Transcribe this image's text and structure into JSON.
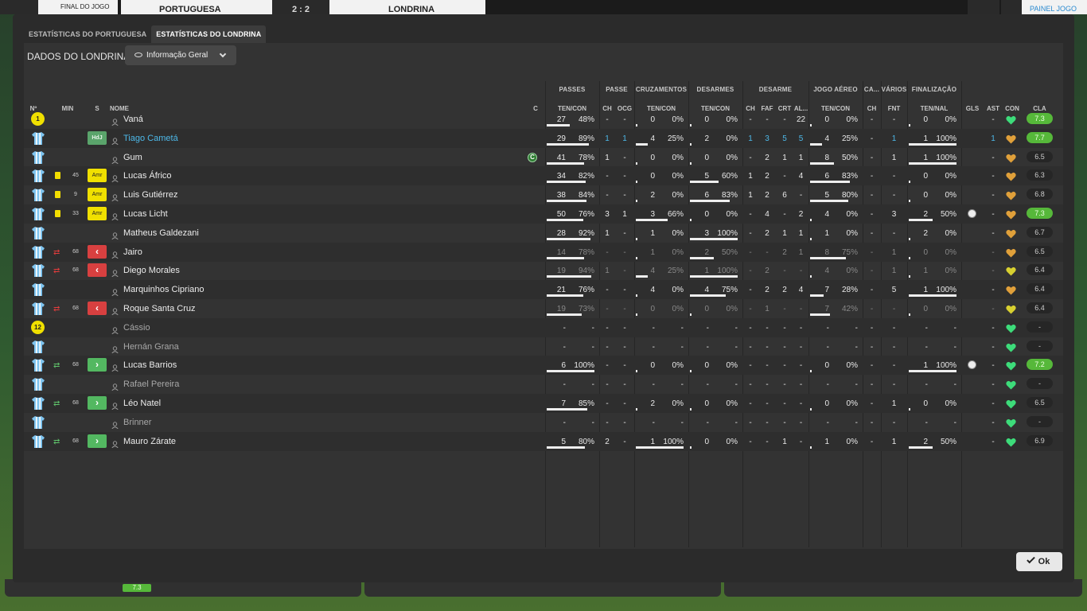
{
  "scoreboard": {
    "status": "FINAL DO JOGO",
    "home_team": "PORTUGUESA",
    "score": "2 : 2",
    "away_team": "LONDRINA",
    "right_label": "PAINEL JOGO"
  },
  "tabs": [
    {
      "label": "ESTATÍSTICAS DO PORTUGUESA",
      "active": false
    },
    {
      "label": "ESTATÍSTICAS DO LONDRINA",
      "active": true
    }
  ],
  "header": {
    "title": "DADOS DO LONDRINA",
    "view_select": "Informação Geral"
  },
  "group_headers": {
    "passes": "PASSES",
    "passe": "PASSE",
    "cruzamentos": "CRUZAMENTOS",
    "desarmes": "DESARMES",
    "desarme": "DESARME",
    "jogo_aereo": "JOGO AÉREO",
    "ca": "CA...",
    "varios": "VÁRIOS",
    "finalizacao": "FINALIZAÇÃO"
  },
  "columns": {
    "num": "Nº",
    "min": "MIN",
    "s": "S",
    "nome": "NOME",
    "c": "C",
    "passes_tencon": "TEN/CON",
    "passe_ch": "CH",
    "passe_ocg": "OCG",
    "cruz_tencon": "TEN/CON",
    "desarmes_tencon": "TEN/CON",
    "des_ch": "CH",
    "des_faf": "FAF",
    "des_crt": "CRT",
    "des_al": "AL...",
    "aereo_tencon": "TEN/CON",
    "ca_ch": "CH",
    "var_fnt": "FNT",
    "fin_tennal": "TEN/NAL",
    "gls": "GLS",
    "ast": "AST",
    "con": "CON",
    "cla": "CLA"
  },
  "rows": [
    {
      "kit": "gk",
      "num": "1",
      "name": "Vaná",
      "card": false,
      "min": "",
      "tag": "",
      "tagtext": "",
      "captain": false,
      "name_style": "",
      "pass": [
        "27",
        "48%"
      ],
      "pass_f": 0.48,
      "ch": "-",
      "ocg": "-",
      "cru": [
        "0",
        "0%"
      ],
      "cru_f": 0,
      "des": [
        "0",
        "0%"
      ],
      "des_f": 0,
      "dch": "-",
      "faf": "-",
      "crt": "-",
      "al": "22",
      "aer": [
        "0",
        "0%"
      ],
      "aer_f": 0,
      "cach": "-",
      "fnt": "-",
      "fin": [
        "0",
        "0%"
      ],
      "fin_f": 0,
      "gls": "",
      "ast": "-",
      "con": "green",
      "cla": "7.3",
      "cla_g": true,
      "blue": []
    },
    {
      "kit": "field",
      "num": "",
      "name": "Tiago Cametá",
      "card": false,
      "min": "",
      "tag": "hdj",
      "tagtext": "HdJ",
      "captain": false,
      "name_style": "bl",
      "pass": [
        "29",
        "89%"
      ],
      "pass_f": 0.89,
      "ch": "1",
      "ocg": "1",
      "cru": [
        "4",
        "25%"
      ],
      "cru_f": 0.25,
      "des": [
        "2",
        "0%"
      ],
      "des_f": 0,
      "dch": "1",
      "faf": "3",
      "crt": "5",
      "al": "5",
      "aer": [
        "4",
        "25%"
      ],
      "aer_f": 0.25,
      "cach": "-",
      "fnt": "1",
      "fin": [
        "1",
        "100%"
      ],
      "fin_f": 1,
      "gls": "",
      "ast": "1",
      "con": "orange",
      "cla": "7.7",
      "cla_g": true,
      "blue": [
        "ch",
        "ocg",
        "dch",
        "faf",
        "crt",
        "al",
        "fnt",
        "ast"
      ]
    },
    {
      "kit": "field",
      "num": "",
      "name": "Gum",
      "card": false,
      "min": "",
      "tag": "",
      "tagtext": "",
      "captain": true,
      "captain_letter": "C",
      "name_style": "",
      "pass": [
        "41",
        "78%"
      ],
      "pass_f": 0.78,
      "ch": "1",
      "ocg": "-",
      "cru": [
        "0",
        "0%"
      ],
      "cru_f": 0,
      "des": [
        "0",
        "0%"
      ],
      "des_f": 0,
      "dch": "-",
      "faf": "2",
      "crt": "1",
      "al": "1",
      "aer": [
        "8",
        "50%"
      ],
      "aer_f": 0.5,
      "cach": "-",
      "fnt": "1",
      "fin": [
        "1",
        "100%"
      ],
      "fin_f": 1,
      "gls": "",
      "ast": "-",
      "con": "orange",
      "cla": "6.5",
      "cla_g": false,
      "blue": []
    },
    {
      "kit": "field",
      "num": "",
      "name": "Lucas Áfrico",
      "card": true,
      "min": "45",
      "tag": "amr",
      "tagtext": "Amr",
      "captain": false,
      "name_style": "",
      "pass": [
        "34",
        "82%"
      ],
      "pass_f": 0.82,
      "ch": "-",
      "ocg": "-",
      "cru": [
        "0",
        "0%"
      ],
      "cru_f": 0,
      "des": [
        "5",
        "60%"
      ],
      "des_f": 0.6,
      "dch": "1",
      "faf": "2",
      "crt": "-",
      "al": "4",
      "aer": [
        "6",
        "83%"
      ],
      "aer_f": 0.83,
      "cach": "-",
      "fnt": "-",
      "fin": [
        "0",
        "0%"
      ],
      "fin_f": 0,
      "gls": "",
      "ast": "-",
      "con": "orange",
      "cla": "6.3",
      "cla_g": false,
      "blue": []
    },
    {
      "kit": "field",
      "num": "",
      "name": "Luis Gutiérrez",
      "card": true,
      "min": "9",
      "tag": "amr",
      "tagtext": "Amr",
      "captain": false,
      "name_style": "",
      "pass": [
        "38",
        "84%"
      ],
      "pass_f": 0.84,
      "ch": "-",
      "ocg": "-",
      "cru": [
        "2",
        "0%"
      ],
      "cru_f": 0,
      "des": [
        "6",
        "83%"
      ],
      "des_f": 0.83,
      "dch": "1",
      "faf": "2",
      "crt": "6",
      "al": "-",
      "aer": [
        "5",
        "80%"
      ],
      "aer_f": 0.8,
      "cach": "-",
      "fnt": "-",
      "fin": [
        "0",
        "0%"
      ],
      "fin_f": 0,
      "gls": "",
      "ast": "-",
      "con": "orange",
      "cla": "6.8",
      "cla_g": false,
      "blue": []
    },
    {
      "kit": "field",
      "num": "",
      "name": "Lucas Licht",
      "card": true,
      "min": "33",
      "tag": "amr",
      "tagtext": "Amr",
      "captain": false,
      "name_style": "",
      "pass": [
        "50",
        "76%"
      ],
      "pass_f": 0.76,
      "ch": "3",
      "ocg": "1",
      "cru": [
        "3",
        "66%"
      ],
      "cru_f": 0.66,
      "des": [
        "0",
        "0%"
      ],
      "des_f": 0,
      "dch": "-",
      "faf": "4",
      "crt": "-",
      "al": "2",
      "aer": [
        "4",
        "0%"
      ],
      "aer_f": 0,
      "cach": "-",
      "fnt": "3",
      "fin": [
        "2",
        "50%"
      ],
      "fin_f": 0.5,
      "gls": "ball",
      "ast": "-",
      "con": "orange",
      "cla": "7.3",
      "cla_g": true,
      "blue": []
    },
    {
      "kit": "field",
      "num": "",
      "name": "Matheus Galdezani",
      "card": false,
      "min": "",
      "tag": "",
      "tagtext": "",
      "captain": false,
      "name_style": "",
      "pass": [
        "28",
        "92%"
      ],
      "pass_f": 0.92,
      "ch": "1",
      "ocg": "-",
      "cru": [
        "1",
        "0%"
      ],
      "cru_f": 0,
      "des": [
        "3",
        "100%"
      ],
      "des_f": 1,
      "dch": "-",
      "faf": "2",
      "crt": "1",
      "al": "1",
      "aer": [
        "1",
        "0%"
      ],
      "aer_f": 0,
      "cach": "-",
      "fnt": "-",
      "fin": [
        "2",
        "0%"
      ],
      "fin_f": 0,
      "gls": "",
      "ast": "-",
      "con": "orange",
      "cla": "6.7",
      "cla_g": false,
      "blue": []
    },
    {
      "kit": "field",
      "num": "",
      "name": "Jairo",
      "card": false,
      "min": "68",
      "sub": "out",
      "tag": "red",
      "tagtext": "‹",
      "captain": false,
      "name_style": "",
      "pass": [
        "14",
        "78%"
      ],
      "pass_f": 0.78,
      "ch": "-",
      "ocg": "-",
      "cru": [
        "1",
        "0%"
      ],
      "cru_f": 0,
      "des": [
        "2",
        "50%"
      ],
      "des_f": 0.5,
      "dch": "-",
      "faf": "-",
      "crt": "2",
      "al": "1",
      "aer": [
        "8",
        "75%"
      ],
      "aer_f": 0.75,
      "cach": "-",
      "fnt": "1",
      "fin": [
        "0",
        "0%"
      ],
      "fin_f": 0,
      "gls": "",
      "ast": "-",
      "con": "orange",
      "cla": "6.5",
      "cla_g": false,
      "blue": [],
      "dim": true
    },
    {
      "kit": "field",
      "num": "",
      "name": "Diego Morales",
      "card": false,
      "min": "68",
      "sub": "out",
      "tag": "red",
      "tagtext": "‹",
      "captain": false,
      "name_style": "",
      "pass": [
        "19",
        "94%"
      ],
      "pass_f": 0.94,
      "ch": "1",
      "ocg": "-",
      "cru": [
        "4",
        "25%"
      ],
      "cru_f": 0.25,
      "des": [
        "1",
        "100%"
      ],
      "des_f": 1,
      "dch": "-",
      "faf": "2",
      "crt": "-",
      "al": "-",
      "aer": [
        "4",
        "0%"
      ],
      "aer_f": 0,
      "cach": "-",
      "fnt": "1",
      "fin": [
        "1",
        "0%"
      ],
      "fin_f": 0,
      "gls": "",
      "ast": "-",
      "con": "yellow",
      "cla": "6.4",
      "cla_g": false,
      "blue": [],
      "dim": true
    },
    {
      "kit": "field",
      "num": "",
      "name": "Marquinhos Cipriano",
      "card": false,
      "min": "",
      "tag": "",
      "tagtext": "",
      "captain": false,
      "name_style": "",
      "pass": [
        "21",
        "76%"
      ],
      "pass_f": 0.76,
      "ch": "-",
      "ocg": "-",
      "cru": [
        "4",
        "0%"
      ],
      "cru_f": 0,
      "des": [
        "4",
        "75%"
      ],
      "des_f": 0.75,
      "dch": "-",
      "faf": "2",
      "crt": "2",
      "al": "4",
      "aer": [
        "7",
        "28%"
      ],
      "aer_f": 0.28,
      "cach": "-",
      "fnt": "5",
      "fin": [
        "1",
        "100%"
      ],
      "fin_f": 1,
      "gls": "",
      "ast": "-",
      "con": "orange",
      "cla": "6.4",
      "cla_g": false,
      "blue": []
    },
    {
      "kit": "field",
      "num": "",
      "name": "Roque Santa Cruz",
      "card": false,
      "min": "68",
      "sub": "out",
      "tag": "red",
      "tagtext": "‹",
      "captain": false,
      "name_style": "",
      "pass": [
        "19",
        "73%"
      ],
      "pass_f": 0.73,
      "ch": "-",
      "ocg": "-",
      "cru": [
        "0",
        "0%"
      ],
      "cru_f": 0,
      "des": [
        "0",
        "0%"
      ],
      "des_f": 0,
      "dch": "-",
      "faf": "1",
      "crt": "-",
      "al": "-",
      "aer": [
        "7",
        "42%"
      ],
      "aer_f": 0.42,
      "cach": "-",
      "fnt": "-",
      "fin": [
        "0",
        "0%"
      ],
      "fin_f": 0,
      "gls": "",
      "ast": "-",
      "con": "yellow",
      "cla": "6.4",
      "cla_g": false,
      "blue": [],
      "dim": true
    },
    {
      "kit": "gk",
      "num": "12",
      "name": "Cássio",
      "card": false,
      "min": "",
      "tag": "",
      "tagtext": "",
      "captain": false,
      "name_style": "dim",
      "pass": [
        "-",
        "-"
      ],
      "pass_f": null,
      "ch": "-",
      "ocg": "-",
      "cru": [
        "-",
        "-"
      ],
      "cru_f": null,
      "des": [
        "-",
        "-"
      ],
      "des_f": null,
      "dch": "-",
      "faf": "-",
      "crt": "-",
      "al": "-",
      "aer": [
        "-",
        "-"
      ],
      "aer_f": null,
      "cach": "-",
      "fnt": "-",
      "fin": [
        "-",
        "-"
      ],
      "fin_f": null,
      "gls": "",
      "ast": "-",
      "con": "green",
      "cla": "-",
      "cla_g": false,
      "blue": []
    },
    {
      "kit": "field",
      "num": "",
      "name": "Hernán Grana",
      "card": false,
      "min": "",
      "tag": "",
      "tagtext": "",
      "captain": false,
      "name_style": "dim",
      "pass": [
        "-",
        "-"
      ],
      "pass_f": null,
      "ch": "-",
      "ocg": "-",
      "cru": [
        "-",
        "-"
      ],
      "cru_f": null,
      "des": [
        "-",
        "-"
      ],
      "des_f": null,
      "dch": "-",
      "faf": "-",
      "crt": "-",
      "al": "-",
      "aer": [
        "-",
        "-"
      ],
      "aer_f": null,
      "cach": "-",
      "fnt": "-",
      "fin": [
        "-",
        "-"
      ],
      "fin_f": null,
      "gls": "",
      "ast": "-",
      "con": "green",
      "cla": "-",
      "cla_g": false,
      "blue": []
    },
    {
      "kit": "field",
      "num": "",
      "name": "Lucas Barrios",
      "card": false,
      "min": "68",
      "sub": "in",
      "tag": "grn",
      "tagtext": "›",
      "captain": false,
      "name_style": "",
      "pass": [
        "6",
        "100%"
      ],
      "pass_f": 1,
      "ch": "-",
      "ocg": "-",
      "cru": [
        "0",
        "0%"
      ],
      "cru_f": 0,
      "des": [
        "0",
        "0%"
      ],
      "des_f": 0,
      "dch": "-",
      "faf": "-",
      "crt": "-",
      "al": "-",
      "aer": [
        "0",
        "0%"
      ],
      "aer_f": 0,
      "cach": "-",
      "fnt": "-",
      "fin": [
        "1",
        "100%"
      ],
      "fin_f": 1,
      "gls": "ball",
      "ast": "-",
      "con": "green",
      "cla": "7.2",
      "cla_g": true,
      "blue": []
    },
    {
      "kit": "field",
      "num": "",
      "name": "Rafael Pereira",
      "card": false,
      "min": "",
      "tag": "",
      "tagtext": "",
      "captain": false,
      "name_style": "dim",
      "pass": [
        "-",
        "-"
      ],
      "pass_f": null,
      "ch": "-",
      "ocg": "-",
      "cru": [
        "-",
        "-"
      ],
      "cru_f": null,
      "des": [
        "-",
        "-"
      ],
      "des_f": null,
      "dch": "-",
      "faf": "-",
      "crt": "-",
      "al": "-",
      "aer": [
        "-",
        "-"
      ],
      "aer_f": null,
      "cach": "-",
      "fnt": "-",
      "fin": [
        "-",
        "-"
      ],
      "fin_f": null,
      "gls": "",
      "ast": "-",
      "con": "green",
      "cla": "-",
      "cla_g": false,
      "blue": []
    },
    {
      "kit": "field",
      "num": "",
      "name": "Léo Natel",
      "card": false,
      "min": "68",
      "sub": "in",
      "tag": "grn",
      "tagtext": "›",
      "captain": false,
      "name_style": "",
      "pass": [
        "7",
        "85%"
      ],
      "pass_f": 0.85,
      "ch": "-",
      "ocg": "-",
      "cru": [
        "2",
        "0%"
      ],
      "cru_f": 0,
      "des": [
        "0",
        "0%"
      ],
      "des_f": 0,
      "dch": "-",
      "faf": "-",
      "crt": "-",
      "al": "-",
      "aer": [
        "0",
        "0%"
      ],
      "aer_f": 0,
      "cach": "-",
      "fnt": "1",
      "fin": [
        "0",
        "0%"
      ],
      "fin_f": 0,
      "gls": "",
      "ast": "-",
      "con": "green",
      "cla": "6.5",
      "cla_g": false,
      "blue": []
    },
    {
      "kit": "field",
      "num": "",
      "name": "Brinner",
      "card": false,
      "min": "",
      "tag": "",
      "tagtext": "",
      "captain": false,
      "name_style": "dim",
      "pass": [
        "-",
        "-"
      ],
      "pass_f": null,
      "ch": "-",
      "ocg": "-",
      "cru": [
        "-",
        "-"
      ],
      "cru_f": null,
      "des": [
        "-",
        "-"
      ],
      "des_f": null,
      "dch": "-",
      "faf": "-",
      "crt": "-",
      "al": "-",
      "aer": [
        "-",
        "-"
      ],
      "aer_f": null,
      "cach": "-",
      "fnt": "-",
      "fin": [
        "-",
        "-"
      ],
      "fin_f": null,
      "gls": "",
      "ast": "-",
      "con": "green",
      "cla": "-",
      "cla_g": false,
      "blue": []
    },
    {
      "kit": "field",
      "num": "",
      "name": "Mauro Zárate",
      "card": false,
      "min": "68",
      "sub": "in",
      "tag": "grn",
      "tagtext": "›",
      "captain": false,
      "name_style": "",
      "pass": [
        "5",
        "80%"
      ],
      "pass_f": 0.8,
      "ch": "2",
      "ocg": "-",
      "cru": [
        "1",
        "100%"
      ],
      "cru_f": 1,
      "des": [
        "0",
        "0%"
      ],
      "des_f": 0,
      "dch": "-",
      "faf": "-",
      "crt": "1",
      "al": "-",
      "aer": [
        "1",
        "0%"
      ],
      "aer_f": 0,
      "cach": "-",
      "fnt": "1",
      "fin": [
        "2",
        "50%"
      ],
      "fin_f": 0.5,
      "gls": "",
      "ast": "-",
      "con": "green",
      "cla": "6.9",
      "cla_g": false,
      "blue": []
    }
  ],
  "ok_button": "Ok",
  "colors": {
    "accent_blue": "#4db8e8",
    "rating_green": "#56b83a",
    "yellow_card": "#f2dd00",
    "morale_green": "#3ddc7a",
    "morale_orange": "#e0a03a",
    "morale_yellow": "#d8d030"
  },
  "bottom_rating": "7.3"
}
